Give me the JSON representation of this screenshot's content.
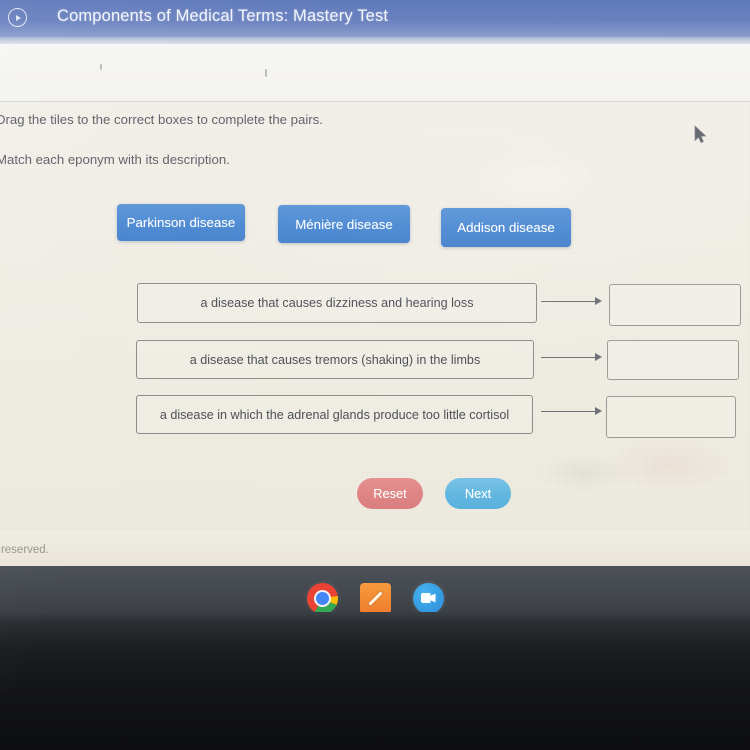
{
  "app": {
    "title": "Components of Medical Terms: Mastery Test",
    "back_icon": "back-arrow-circle-icon"
  },
  "instructions": {
    "line1": "Drag the tiles to the correct boxes to complete the pairs.",
    "line2": "Match each eponym with its description."
  },
  "tiles": [
    {
      "label": "Parkinson disease"
    },
    {
      "label": "Ménière disease"
    },
    {
      "label": "Addison disease"
    }
  ],
  "pairs": [
    {
      "description": "a disease that causes dizziness and hearing loss",
      "answer": ""
    },
    {
      "description": "a disease that causes tremors (shaking) in the limbs",
      "answer": ""
    },
    {
      "description": "a disease in which the adrenal glands produce too little cortisol",
      "answer": ""
    }
  ],
  "buttons": {
    "reset": "Reset",
    "next": "Next"
  },
  "footer": {
    "text": "s reserved."
  },
  "shelf": {
    "icons": [
      {
        "name": "chrome-icon",
        "label": ""
      },
      {
        "name": "notes-pencil-icon",
        "label": ""
      },
      {
        "name": "zoom-video-icon",
        "label": ""
      }
    ]
  },
  "colors": {
    "header": "#6a81bf",
    "tile": "#4b89d2",
    "reset": "#de8484",
    "next": "#62b7df",
    "page_bg": "#f1eee5",
    "shelf": "#44494f"
  }
}
